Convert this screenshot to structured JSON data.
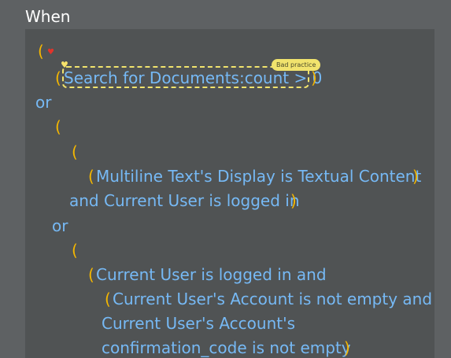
{
  "section": {
    "label": "When"
  },
  "badge": {
    "label": "Bad practice"
  },
  "expression": {
    "l1_open": "(",
    "l2_open": "(",
    "l2_text": "Search for Documents:count > 0",
    "l2_close": ")",
    "l3_or": "or",
    "l4_open": "(",
    "l5_open": "(",
    "l6_open": "(",
    "l6_text": "Multiline Text's Display is Textual Content",
    "l6_close": ")",
    "l7_text": "and Current User is logged in",
    "l7_close": ")",
    "l8_or": "or",
    "l9_open": "(",
    "l10_open": "(",
    "l10_text": "Current User is logged in and",
    "l11_open": "(",
    "l11_text": "Current User's Account is not empty and",
    "l12_text": "Current User's Account's",
    "l13_text": "confirmation_code is not empty",
    "l13_close": ")"
  },
  "icons": {
    "heart_red": "heart-icon",
    "heart_yellow": "heart-icon"
  },
  "colors": {
    "background": "#5e6163",
    "editor_background": "#505354",
    "paren": "#f5b700",
    "expression_text": "#76b9f5",
    "bad_practice": "#f1e36d",
    "heart": "#e2342b"
  }
}
